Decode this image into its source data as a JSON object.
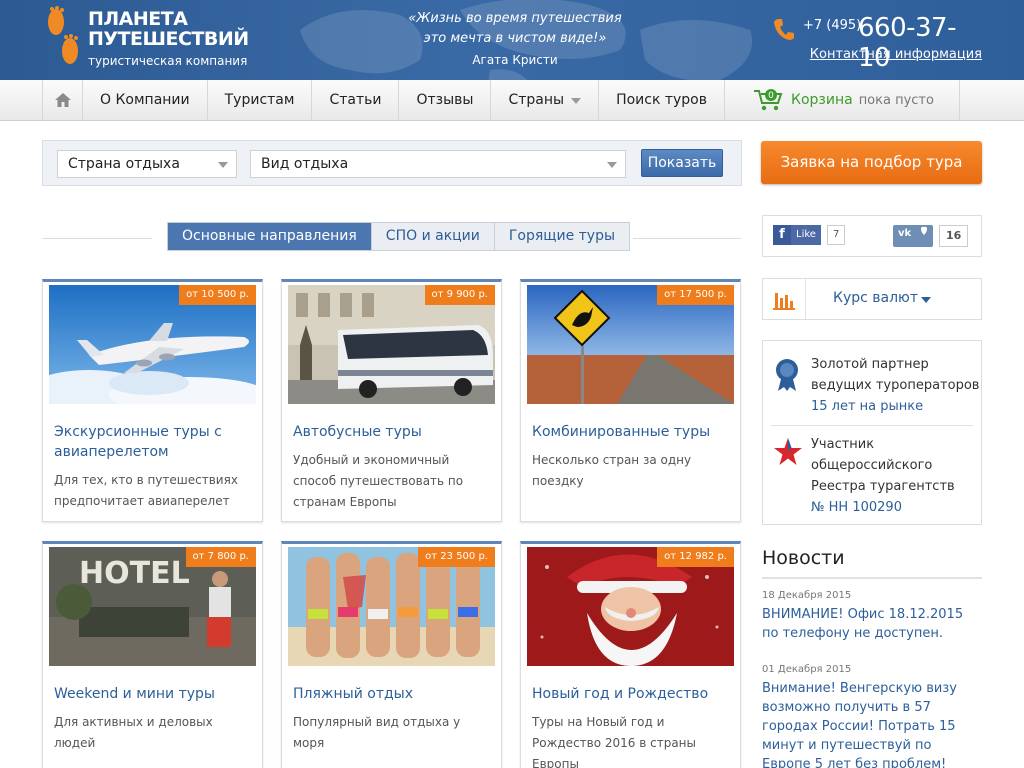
{
  "header": {
    "logo_line1": "ПЛАНЕТА",
    "logo_line2": "ПУТЕШЕСТВИЙ",
    "logo_sub": "туристическая компания",
    "quote_line1": "«Жизнь во время путешествия",
    "quote_line2": "это мечта в чистом виде!»",
    "quote_author": "Агата Кристи",
    "phone_code": "+7 (495)",
    "phone_number": "660-37-10",
    "contact_link": "Контактная информация"
  },
  "nav": {
    "items": [
      "О Компании",
      "Туристам",
      "Статьи",
      "Отзывы",
      "Страны",
      "Поиск туров"
    ],
    "cart_label": "Корзина",
    "cart_status": "пока пусто",
    "cart_count": "0"
  },
  "search": {
    "country_select": "Страна отдыха",
    "type_select": "Вид отдыха",
    "show_button": "Показать"
  },
  "order_button": "Заявка на подбор тура",
  "tabs": [
    "Основные направления",
    "СПО и акции",
    "Горящие туры"
  ],
  "cards": [
    {
      "price": "от 10 500 р.",
      "title": "Экскурсионные туры с авиаперелетом",
      "desc": "Для тех, кто в путешествиях предпочитает авиаперелет"
    },
    {
      "price": "от 9 900 р.",
      "title": "Автобусные туры",
      "desc": "Удобный и экономичный способ путешествовать по странам Европы"
    },
    {
      "price": "от 17 500 р.",
      "title": "Комбинированные туры",
      "desc": "Несколько стран за одну поездку"
    },
    {
      "price": "от 7 800 р.",
      "title": "Weekend и мини туры",
      "desc": "Для активных и деловых людей"
    },
    {
      "price": "от 23 500 р.",
      "title": "Пляжный отдых",
      "desc": "Популярный вид отдыха у моря"
    },
    {
      "price": "от 12 982 р.",
      "title": "Новый год и Рождество",
      "desc": "Туры на Новый год и Рождество 2016 в страны Европы"
    }
  ],
  "social": {
    "fb_label": "Like",
    "fb_count": "7",
    "vk_count": "16"
  },
  "currency_label": "Курс валют",
  "partner": {
    "line1": "Золотой партнер",
    "line2": "ведущих туроператоров",
    "line3": "15 лет на рынке",
    "reg1": "Участник",
    "reg2": "общероссийского",
    "reg3": "Реестра турагентств",
    "reg4": "№ НН 100290"
  },
  "news": {
    "heading": "Новости",
    "items": [
      {
        "date": "18 Декабря 2015",
        "text": "ВНИМАНИЕ! Офис 18.12.2015 по телефону не доступен."
      },
      {
        "date": "01 Декабря 2015",
        "text": "Внимание! Венгерскую визу возможно получить в 57 городах России! Потрать 15 минут и путешествуй по Европе 5 лет без проблем!"
      }
    ]
  },
  "colors": {
    "header_blue": "#2f5f9b",
    "accent_orange": "#ef7d1c",
    "link_blue": "#2c5f99",
    "cart_green": "#3e9a2e"
  }
}
